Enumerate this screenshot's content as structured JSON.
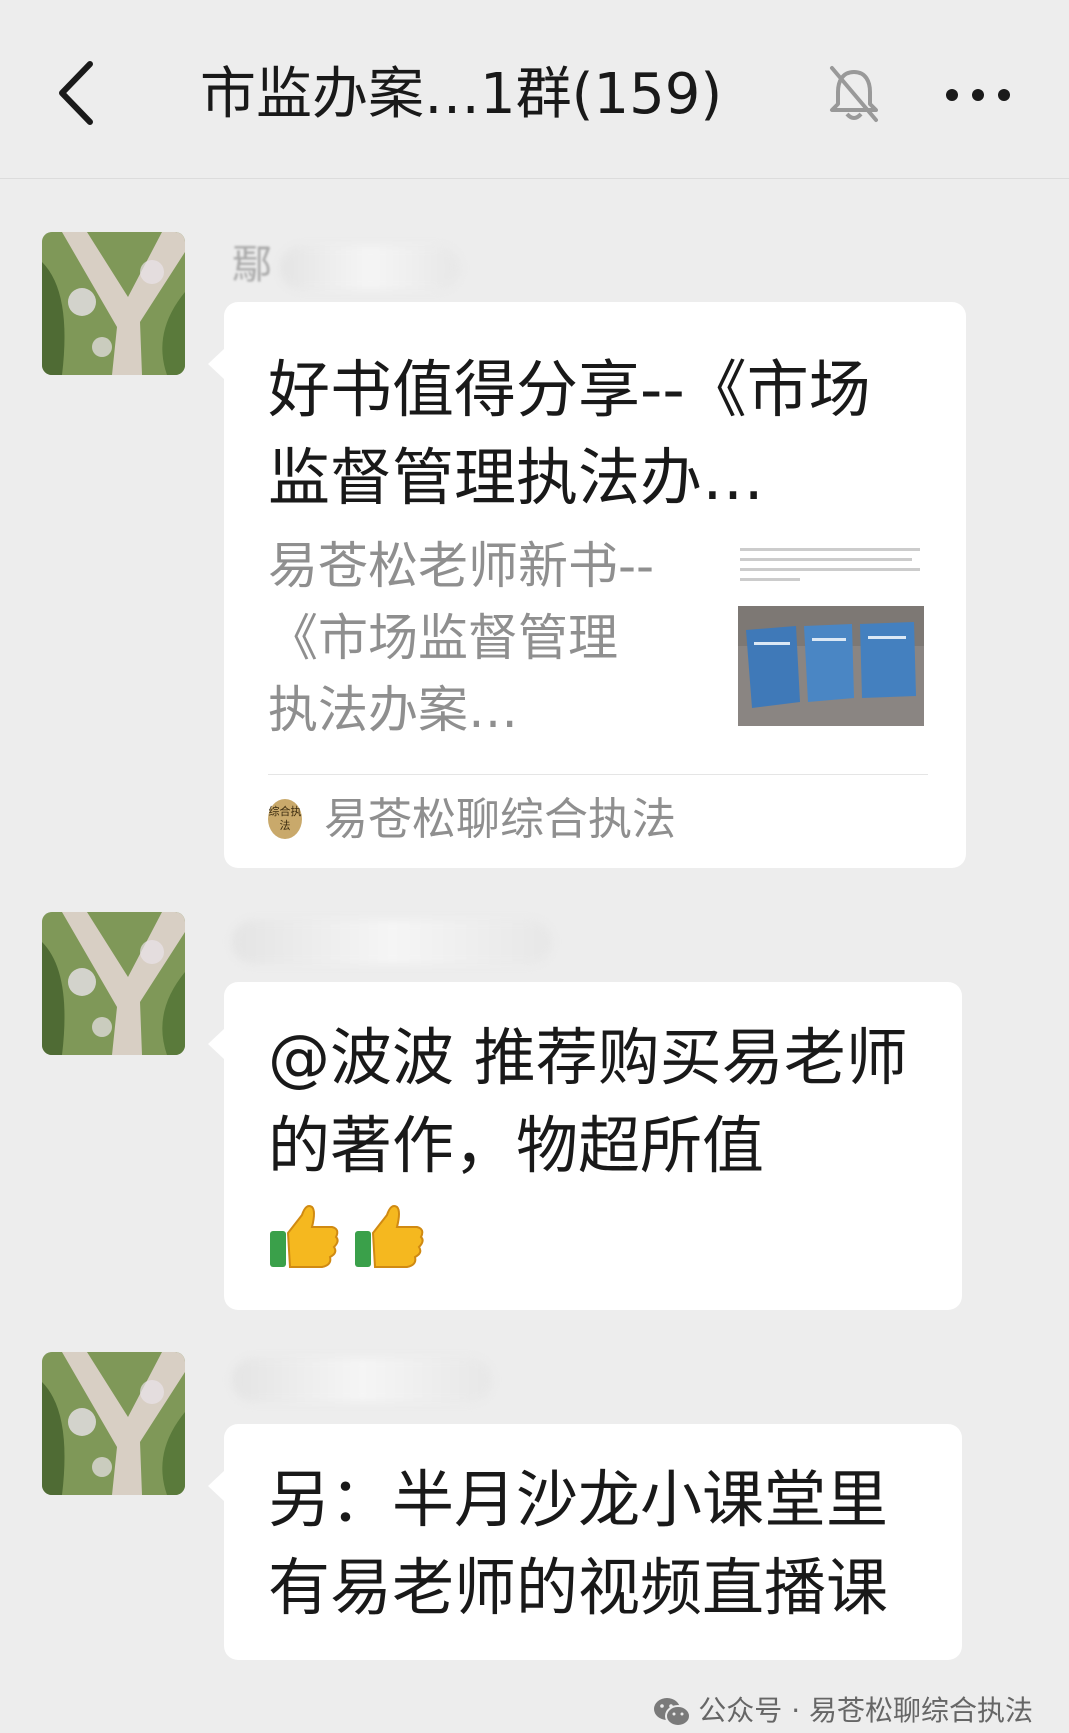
{
  "header": {
    "title": "市监办案…1群(159)",
    "icons": [
      "back-icon",
      "mute-bell-icon",
      "more-icon"
    ]
  },
  "messages": [
    {
      "sender": "鄢",
      "type": "link_card",
      "title": "好书值得分享--《市场监督管理执法办…",
      "description": "易苍松老师新书--《市场监督管理执法办案…",
      "source_badge": "综合执法",
      "source": "易苍松聊综合执法"
    },
    {
      "type": "text",
      "text": "@波波  推荐购买易老师的著作，物超所值",
      "emoji": [
        "thumbs-up",
        "thumbs-up"
      ]
    },
    {
      "type": "text",
      "text": "另：半月沙龙小课堂里有易老师的视频直播课"
    }
  ],
  "watermark": "公众号 · 易苍松聊综合执法",
  "colors": {
    "background": "#ededed",
    "bubble": "#ffffff",
    "text": "#191919",
    "secondary_text": "#8f8f8f"
  }
}
